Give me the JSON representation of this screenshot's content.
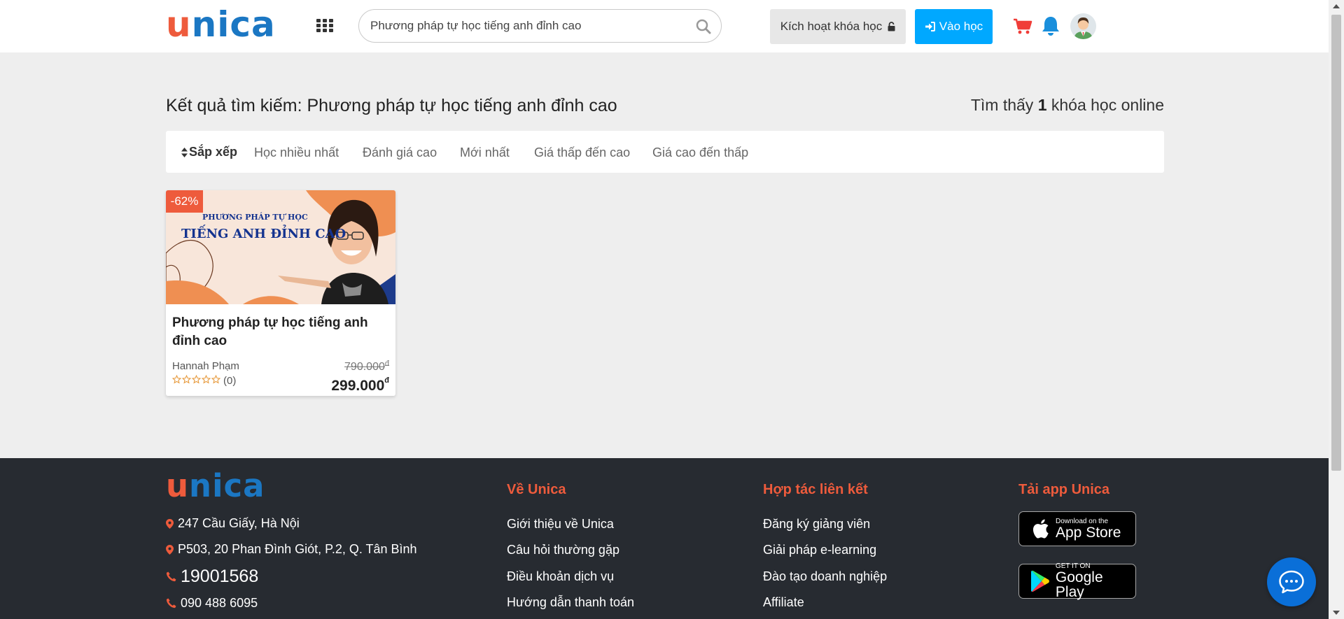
{
  "brand": {
    "logo_first": "u",
    "logo_rest": "nica",
    "primary": "#1b77c3",
    "accent": "#ee5b3c",
    "button_blue": "#00a8ff"
  },
  "header": {
    "menu_icon": "grid-icon",
    "search": {
      "value": "Phương pháp tự học tiếng anh đỉnh cao",
      "icon": "search-icon"
    },
    "activate_label": "Kích hoạt khóa học",
    "login_label": "Vào học",
    "icons": [
      "lock-icon",
      "sign-in-icon",
      "cart-icon",
      "bell-icon",
      "avatar"
    ]
  },
  "main": {
    "title": "Kết quả tìm kiếm: Phương pháp tự học tiếng anh đỉnh cao",
    "count_prefix": "Tìm thấy",
    "count": "1",
    "count_suffix": "khóa học online",
    "sort": {
      "label": "Sắp xếp",
      "options": [
        "Học nhiều nhất",
        "Đánh giá cao",
        "Mới nhất",
        "Giá thấp đến cao",
        "Giá cao đến thấp"
      ]
    },
    "courses": [
      {
        "discount": "-62%",
        "thumb_line1": "PHƯƠNG PHÁP TỰ HỌC",
        "thumb_line2": "TIẾNG ANH ĐỈNH CAO",
        "title": "Phương pháp tự học tiếng anh đỉnh cao",
        "instructor": "Hannah Phạm",
        "rating": 0,
        "rating_count": "(0)",
        "old_price": "790.000",
        "new_price": "299.000",
        "currency": "đ"
      }
    ]
  },
  "footer": {
    "contacts": [
      {
        "icon": "map-marker-icon",
        "text": "247 Cầu Giấy, Hà Nội"
      },
      {
        "icon": "map-marker-icon",
        "text": "P503, 20 Phan Đình Giót, P.2, Q. Tân Bình"
      },
      {
        "icon": "phone-icon",
        "text": "19001568"
      },
      {
        "icon": "phone-icon",
        "text": "090 488 6095"
      }
    ],
    "columns": [
      {
        "title": "Về Unica",
        "links": [
          "Giới thiệu về Unica",
          "Câu hỏi thường gặp",
          "Điều khoản dịch vụ",
          "Hướng dẫn thanh toán"
        ]
      },
      {
        "title": "Hợp tác liên kết",
        "links": [
          "Đăng ký giảng viên",
          "Giải pháp e-learning",
          "Đào tạo doanh nghiệp",
          "Affiliate"
        ]
      }
    ],
    "app": {
      "title": "Tải app Unica",
      "appstore_small": "Download on the",
      "appstore_big": "App Store",
      "googleplay_small": "GET IT ON",
      "googleplay_big": "Google Play"
    }
  },
  "chat_icon": "chat-bubble-icon"
}
